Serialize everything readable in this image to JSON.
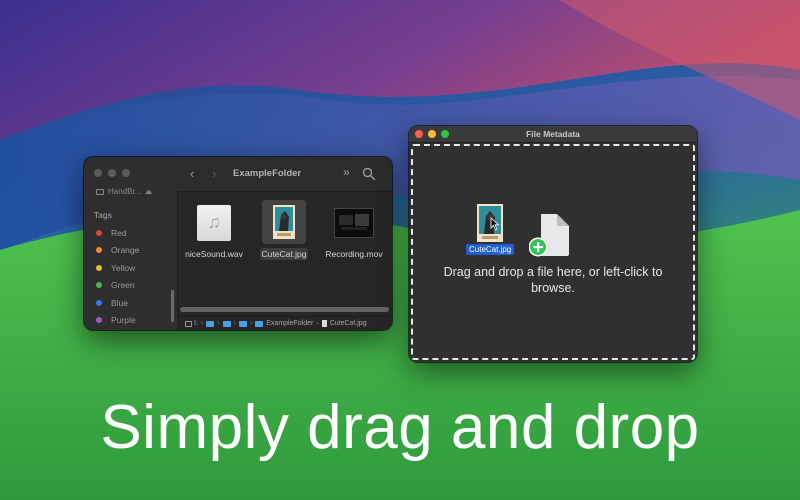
{
  "finder": {
    "sidebar_partial_item": "HandBr...",
    "tags_title": "Tags",
    "tags": [
      {
        "label": "Red",
        "color": "#e0443e"
      },
      {
        "label": "Orange",
        "color": "#ef8a2b"
      },
      {
        "label": "Yellow",
        "color": "#e5c02e"
      },
      {
        "label": "Green",
        "color": "#4bb94a"
      },
      {
        "label": "Blue",
        "color": "#3478f6"
      },
      {
        "label": "Purple",
        "color": "#a352cc"
      }
    ],
    "folder_title": "ExampleFolder",
    "files": [
      {
        "name": "niceSound.wav",
        "icon": "audio-file-icon"
      },
      {
        "name": "CuteCat.jpg",
        "icon": "image-file-icon",
        "selected": true
      },
      {
        "name": "Recording.mov",
        "icon": "video-file-icon"
      }
    ],
    "path": {
      "truncated": "I:",
      "folder": "ExampleFolder",
      "file": "CuteCat.jpg"
    }
  },
  "metadata_window": {
    "title": "File Metadata",
    "dragged_file": "CuteCat.jpg",
    "drop_text": "Drag and drop a file here, or left-click to browse."
  },
  "caption": "Simply drag and drop",
  "colors": {
    "accent_blue": "#1f5fd1",
    "add_badge_green": "#2fc653",
    "traffic_red": "#ff5f57",
    "traffic_yellow": "#febc2e",
    "traffic_green": "#28c840"
  }
}
